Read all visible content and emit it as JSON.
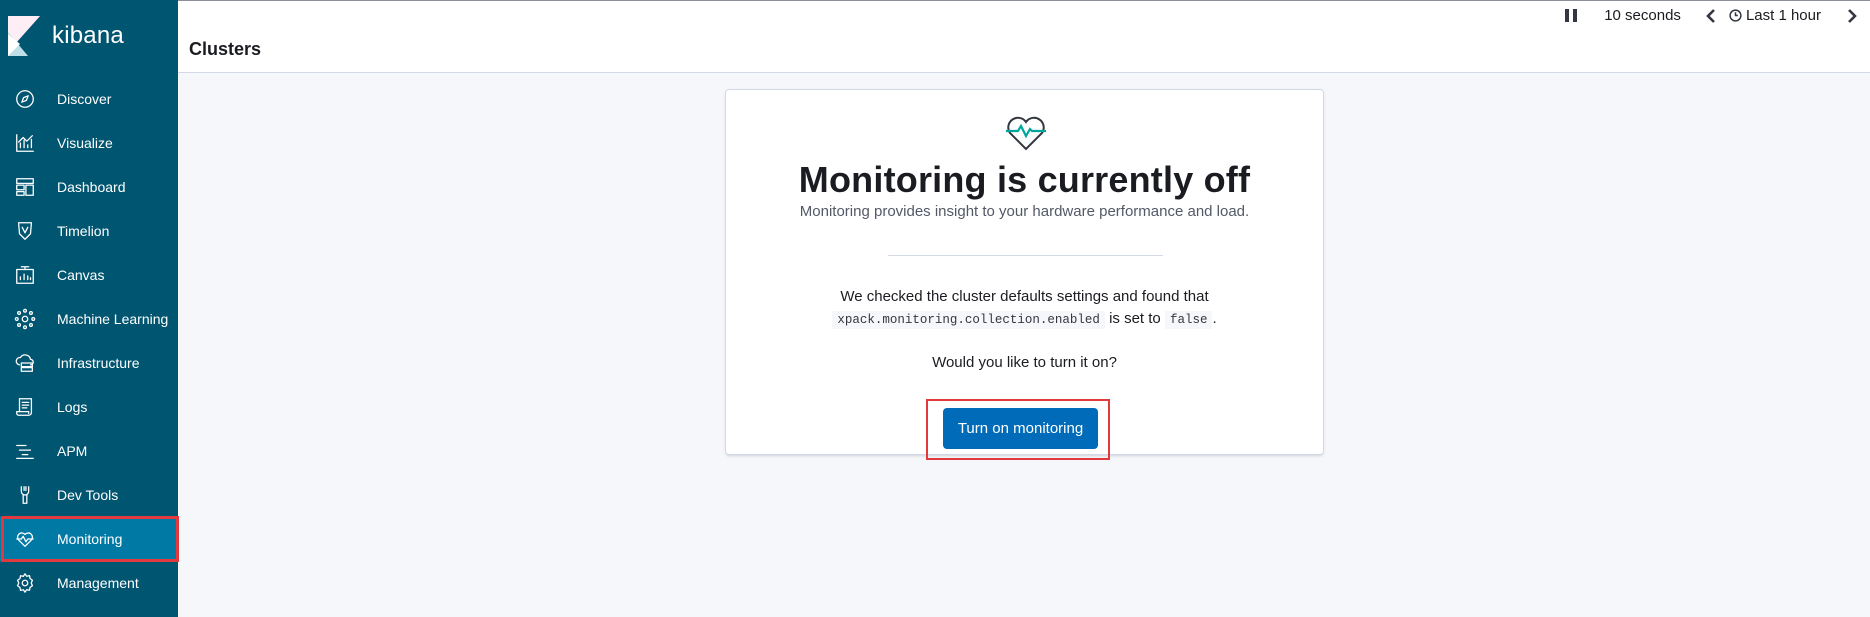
{
  "app": {
    "name": "kibana"
  },
  "sidebar": {
    "items": [
      {
        "label": "Discover",
        "icon": "compass-icon"
      },
      {
        "label": "Visualize",
        "icon": "visualize-icon"
      },
      {
        "label": "Dashboard",
        "icon": "dashboard-icon"
      },
      {
        "label": "Timelion",
        "icon": "timelion-icon"
      },
      {
        "label": "Canvas",
        "icon": "canvas-icon"
      },
      {
        "label": "Machine Learning",
        "icon": "machine-learning-icon"
      },
      {
        "label": "Infrastructure",
        "icon": "infrastructure-icon"
      },
      {
        "label": "Logs",
        "icon": "logs-icon"
      },
      {
        "label": "APM",
        "icon": "apm-icon"
      },
      {
        "label": "Dev Tools",
        "icon": "wrench-icon"
      },
      {
        "label": "Monitoring",
        "icon": "heartbeat-icon",
        "active": true
      },
      {
        "label": "Management",
        "icon": "gear-icon"
      }
    ]
  },
  "header": {
    "title": "Clusters",
    "refresh_interval": "10 seconds",
    "time_range": "Last 1 hour"
  },
  "panel": {
    "title": "Monitoring is currently off",
    "subtitle": "Monitoring provides insight to your hardware performance and load.",
    "explain_line1": "We checked the cluster defaults settings and found that",
    "setting_name": "xpack.monitoring.collection.enabled",
    "is_set_to": "is set to",
    "setting_value": "false",
    "period": ".",
    "question": "Would you like to turn it on?",
    "button_label": "Turn on monitoring"
  },
  "colors": {
    "sidebar_bg": "#005571",
    "sidebar_active": "#0079a5",
    "primary_button": "#006bb8",
    "highlight_border": "#e0393e",
    "heart_accent": "#00a69b"
  }
}
